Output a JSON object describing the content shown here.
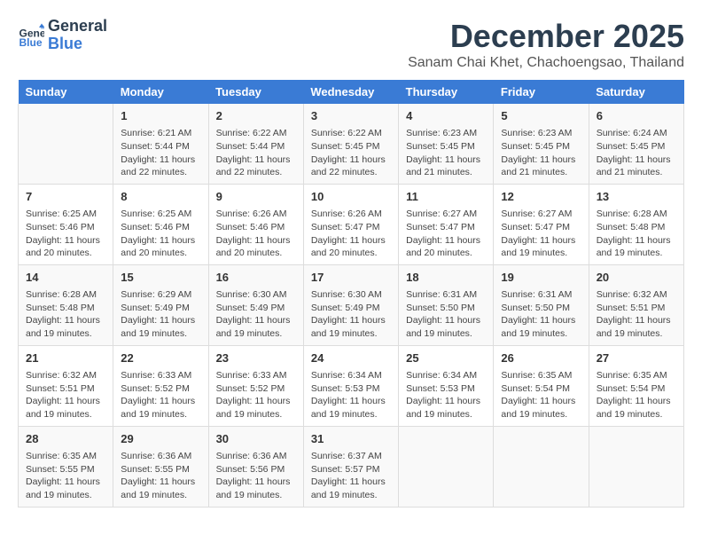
{
  "header": {
    "logo_line1": "General",
    "logo_line2": "Blue",
    "month_title": "December 2025",
    "subtitle": "Sanam Chai Khet, Chachoengsao, Thailand"
  },
  "days_of_week": [
    "Sunday",
    "Monday",
    "Tuesday",
    "Wednesday",
    "Thursday",
    "Friday",
    "Saturday"
  ],
  "weeks": [
    [
      {
        "day": "",
        "info": ""
      },
      {
        "day": "1",
        "info": "Sunrise: 6:21 AM\nSunset: 5:44 PM\nDaylight: 11 hours and 22 minutes."
      },
      {
        "day": "2",
        "info": "Sunrise: 6:22 AM\nSunset: 5:44 PM\nDaylight: 11 hours and 22 minutes."
      },
      {
        "day": "3",
        "info": "Sunrise: 6:22 AM\nSunset: 5:45 PM\nDaylight: 11 hours and 22 minutes."
      },
      {
        "day": "4",
        "info": "Sunrise: 6:23 AM\nSunset: 5:45 PM\nDaylight: 11 hours and 21 minutes."
      },
      {
        "day": "5",
        "info": "Sunrise: 6:23 AM\nSunset: 5:45 PM\nDaylight: 11 hours and 21 minutes."
      },
      {
        "day": "6",
        "info": "Sunrise: 6:24 AM\nSunset: 5:45 PM\nDaylight: 11 hours and 21 minutes."
      }
    ],
    [
      {
        "day": "7",
        "info": "Sunrise: 6:25 AM\nSunset: 5:46 PM\nDaylight: 11 hours and 20 minutes."
      },
      {
        "day": "8",
        "info": "Sunrise: 6:25 AM\nSunset: 5:46 PM\nDaylight: 11 hours and 20 minutes."
      },
      {
        "day": "9",
        "info": "Sunrise: 6:26 AM\nSunset: 5:46 PM\nDaylight: 11 hours and 20 minutes."
      },
      {
        "day": "10",
        "info": "Sunrise: 6:26 AM\nSunset: 5:47 PM\nDaylight: 11 hours and 20 minutes."
      },
      {
        "day": "11",
        "info": "Sunrise: 6:27 AM\nSunset: 5:47 PM\nDaylight: 11 hours and 20 minutes."
      },
      {
        "day": "12",
        "info": "Sunrise: 6:27 AM\nSunset: 5:47 PM\nDaylight: 11 hours and 19 minutes."
      },
      {
        "day": "13",
        "info": "Sunrise: 6:28 AM\nSunset: 5:48 PM\nDaylight: 11 hours and 19 minutes."
      }
    ],
    [
      {
        "day": "14",
        "info": "Sunrise: 6:28 AM\nSunset: 5:48 PM\nDaylight: 11 hours and 19 minutes."
      },
      {
        "day": "15",
        "info": "Sunrise: 6:29 AM\nSunset: 5:49 PM\nDaylight: 11 hours and 19 minutes."
      },
      {
        "day": "16",
        "info": "Sunrise: 6:30 AM\nSunset: 5:49 PM\nDaylight: 11 hours and 19 minutes."
      },
      {
        "day": "17",
        "info": "Sunrise: 6:30 AM\nSunset: 5:49 PM\nDaylight: 11 hours and 19 minutes."
      },
      {
        "day": "18",
        "info": "Sunrise: 6:31 AM\nSunset: 5:50 PM\nDaylight: 11 hours and 19 minutes."
      },
      {
        "day": "19",
        "info": "Sunrise: 6:31 AM\nSunset: 5:50 PM\nDaylight: 11 hours and 19 minutes."
      },
      {
        "day": "20",
        "info": "Sunrise: 6:32 AM\nSunset: 5:51 PM\nDaylight: 11 hours and 19 minutes."
      }
    ],
    [
      {
        "day": "21",
        "info": "Sunrise: 6:32 AM\nSunset: 5:51 PM\nDaylight: 11 hours and 19 minutes."
      },
      {
        "day": "22",
        "info": "Sunrise: 6:33 AM\nSunset: 5:52 PM\nDaylight: 11 hours and 19 minutes."
      },
      {
        "day": "23",
        "info": "Sunrise: 6:33 AM\nSunset: 5:52 PM\nDaylight: 11 hours and 19 minutes."
      },
      {
        "day": "24",
        "info": "Sunrise: 6:34 AM\nSunset: 5:53 PM\nDaylight: 11 hours and 19 minutes."
      },
      {
        "day": "25",
        "info": "Sunrise: 6:34 AM\nSunset: 5:53 PM\nDaylight: 11 hours and 19 minutes."
      },
      {
        "day": "26",
        "info": "Sunrise: 6:35 AM\nSunset: 5:54 PM\nDaylight: 11 hours and 19 minutes."
      },
      {
        "day": "27",
        "info": "Sunrise: 6:35 AM\nSunset: 5:54 PM\nDaylight: 11 hours and 19 minutes."
      }
    ],
    [
      {
        "day": "28",
        "info": "Sunrise: 6:35 AM\nSunset: 5:55 PM\nDaylight: 11 hours and 19 minutes."
      },
      {
        "day": "29",
        "info": "Sunrise: 6:36 AM\nSunset: 5:55 PM\nDaylight: 11 hours and 19 minutes."
      },
      {
        "day": "30",
        "info": "Sunrise: 6:36 AM\nSunset: 5:56 PM\nDaylight: 11 hours and 19 minutes."
      },
      {
        "day": "31",
        "info": "Sunrise: 6:37 AM\nSunset: 5:57 PM\nDaylight: 11 hours and 19 minutes."
      },
      {
        "day": "",
        "info": ""
      },
      {
        "day": "",
        "info": ""
      },
      {
        "day": "",
        "info": ""
      }
    ]
  ]
}
